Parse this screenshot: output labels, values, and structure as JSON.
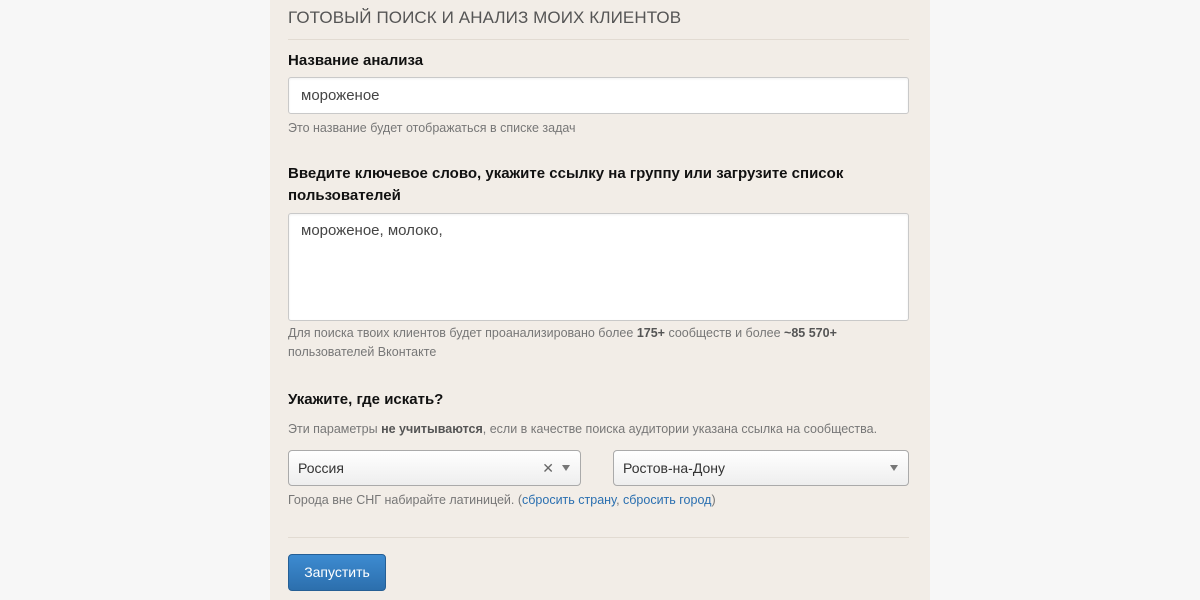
{
  "header": {
    "title": "ГОТОВЫЙ ПОИСК И АНАЛИЗ МОИХ КЛИЕНТОВ"
  },
  "analysis_name": {
    "label": "Название анализа",
    "value": "мороженое",
    "help": "Это название будет отображаться в списке задач"
  },
  "keywords": {
    "label_line1": "Введите ключевое слово, укажите ссылку на группу или загрузите список",
    "label_line2": "пользователей",
    "value": "мороженое, молоко,",
    "help_part1": "Для поиска твоих клиентов будет проанализировано более ",
    "communities_count": "175+",
    "help_part2": " сообществ и более ",
    "users_count": "~85 570+",
    "help_line2": "пользователей Вконтакте"
  },
  "location": {
    "label": "Укажите, где искать?",
    "note_part1": "Эти параметры ",
    "note_bold": "не учитываются",
    "note_part2": ", если в качестве поиска аудитории указана ссылка на сообщества.",
    "country_value": "Россия",
    "city_value": "Ростов-на-Дону",
    "hint_prefix": "Города вне СНГ набирайте латиницей. (",
    "reset_country_link": "сбросить страну",
    "separator": ", ",
    "reset_city_link": "сбросить город",
    "hint_suffix": ")"
  },
  "actions": {
    "run_button": "Запустить"
  }
}
